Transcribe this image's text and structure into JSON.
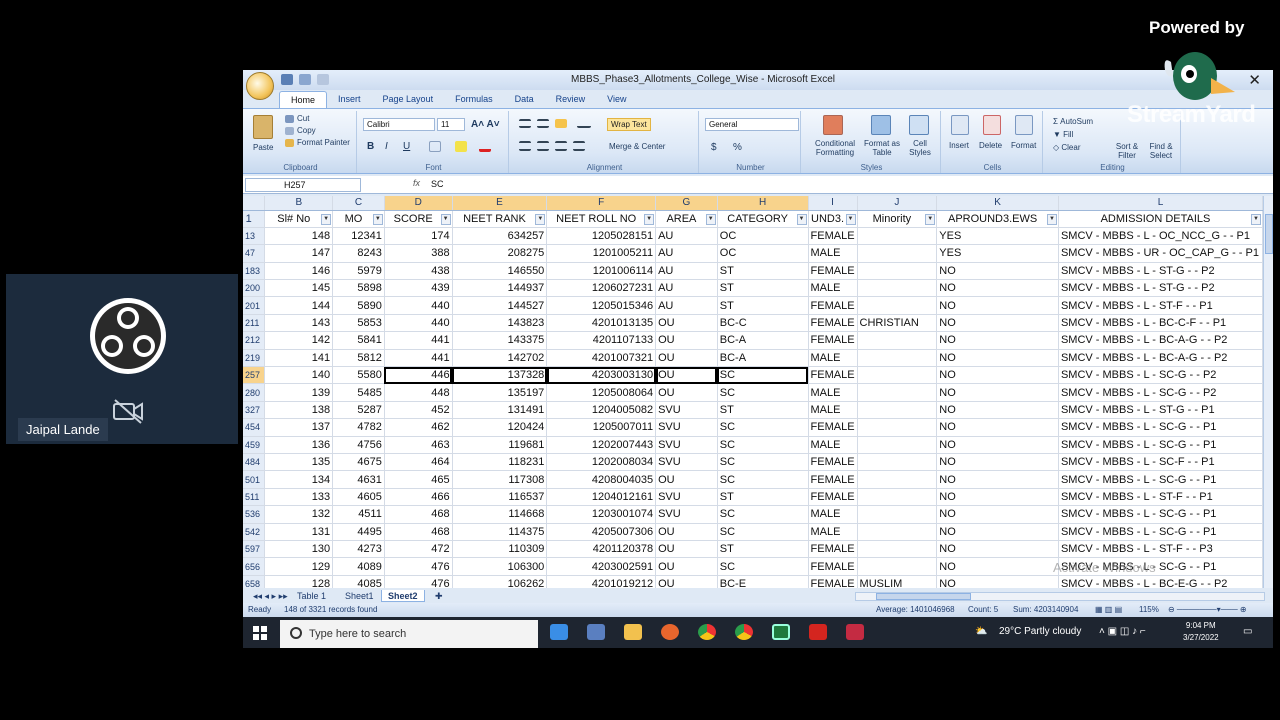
{
  "overlay": {
    "powered_by": "Powered by",
    "brand": "StreamYard",
    "participant_name": "Jaipal Lande"
  },
  "window": {
    "title": "MBBS_Phase3_Allotments_College_Wise - Microsoft Excel"
  },
  "tabs": [
    "Home",
    "Insert",
    "Page Layout",
    "Formulas",
    "Data",
    "Review",
    "View"
  ],
  "ribbon": {
    "clipboard": {
      "paste": "Paste",
      "cut": "Cut",
      "copy": "Copy",
      "format_painter": "Format Painter",
      "label": "Clipboard"
    },
    "font": {
      "name": "Calibri",
      "size": "11",
      "label": "Font",
      "bold": "B",
      "italic": "I",
      "underline": "U"
    },
    "alignment": {
      "wrap_text": "Wrap Text",
      "merge_center": "Merge & Center",
      "label": "Alignment"
    },
    "number": {
      "format": "General",
      "currency": "$",
      "percent": "%",
      "label": "Number"
    },
    "styles": {
      "conditional": "Conditional Formatting",
      "format_table": "Format as Table",
      "cell_styles": "Cell Styles",
      "label": "Styles"
    },
    "cells": {
      "insert": "Insert",
      "delete": "Delete",
      "format": "Format",
      "label": "Cells"
    },
    "editing": {
      "autosum": "AutoSum",
      "fill": "Fill",
      "clear": "Clear",
      "sort": "Sort & Filter",
      "find": "Find & Select",
      "label": "Editing"
    }
  },
  "formula_bar": {
    "name_box": "H257",
    "fx": "fx",
    "content": "SC"
  },
  "columns": [
    "B",
    "C",
    "D",
    "E",
    "F",
    "G",
    "H",
    "I",
    "J",
    "K",
    "L"
  ],
  "header_row_num": "1",
  "headers": [
    "Sl# No",
    "MO",
    "SCORE",
    "NEET RANK",
    "NEET ROLL NO",
    "AREA",
    "CATEGORY",
    "UND3.",
    "Minority",
    "APROUND3.EWS",
    "ADMISSION DETAILS"
  ],
  "rows": [
    {
      "r": "13",
      "cells": [
        "148",
        "12341",
        "174",
        "634257",
        "1205028151",
        "AU",
        "OC",
        "FEMALE",
        "",
        "YES",
        "SMCV - MBBS - L - OC_NCC_G - - P1"
      ]
    },
    {
      "r": "47",
      "cells": [
        "147",
        "8243",
        "388",
        "208275",
        "1201005211",
        "AU",
        "OC",
        "MALE",
        "",
        "YES",
        "SMCV - MBBS - UR - OC_CAP_G - - P1"
      ]
    },
    {
      "r": "183",
      "cells": [
        "146",
        "5979",
        "438",
        "146550",
        "1201006114",
        "AU",
        "ST",
        "FEMALE",
        "",
        "NO",
        "SMCV - MBBS - L - ST-G - - P2"
      ]
    },
    {
      "r": "200",
      "cells": [
        "145",
        "5898",
        "439",
        "144937",
        "1206027231",
        "AU",
        "ST",
        "MALE",
        "",
        "NO",
        "SMCV - MBBS - L - ST-G - - P2"
      ]
    },
    {
      "r": "201",
      "cells": [
        "144",
        "5890",
        "440",
        "144527",
        "1205015346",
        "AU",
        "ST",
        "FEMALE",
        "",
        "NO",
        "SMCV - MBBS - L - ST-F - - P1"
      ]
    },
    {
      "r": "211",
      "cells": [
        "143",
        "5853",
        "440",
        "143823",
        "4201013135",
        "OU",
        "BC-C",
        "FEMALE",
        "CHRISTIAN",
        "NO",
        "SMCV - MBBS - L - BC-C-F - - P1"
      ]
    },
    {
      "r": "212",
      "cells": [
        "142",
        "5841",
        "441",
        "143375",
        "4201107133",
        "OU",
        "BC-A",
        "FEMALE",
        "",
        "NO",
        "SMCV - MBBS - L - BC-A-G - - P2"
      ]
    },
    {
      "r": "219",
      "cells": [
        "141",
        "5812",
        "441",
        "142702",
        "4201007321",
        "OU",
        "BC-A",
        "MALE",
        "",
        "NO",
        "SMCV - MBBS - L - BC-A-G - - P2"
      ]
    },
    {
      "r": "257",
      "cells": [
        "140",
        "5580",
        "446",
        "137328",
        "4203003130",
        "OU",
        "SC",
        "FEMALE",
        "",
        "NO",
        "SMCV - MBBS - L - SC-G - - P2"
      ]
    },
    {
      "r": "280",
      "cells": [
        "139",
        "5485",
        "448",
        "135197",
        "1205008064",
        "OU",
        "SC",
        "MALE",
        "",
        "NO",
        "SMCV - MBBS - L - SC-G - - P2"
      ]
    },
    {
      "r": "327",
      "cells": [
        "138",
        "5287",
        "452",
        "131491",
        "1204005082",
        "SVU",
        "ST",
        "MALE",
        "",
        "NO",
        "SMCV - MBBS - L - ST-G - - P1"
      ]
    },
    {
      "r": "454",
      "cells": [
        "137",
        "4782",
        "462",
        "120424",
        "1205007011",
        "SVU",
        "SC",
        "FEMALE",
        "",
        "NO",
        "SMCV - MBBS - L - SC-G - - P1"
      ]
    },
    {
      "r": "459",
      "cells": [
        "136",
        "4756",
        "463",
        "119681",
        "1202007443",
        "SVU",
        "SC",
        "MALE",
        "",
        "NO",
        "SMCV - MBBS - L - SC-G - - P1"
      ]
    },
    {
      "r": "484",
      "cells": [
        "135",
        "4675",
        "464",
        "118231",
        "1202008034",
        "SVU",
        "SC",
        "FEMALE",
        "",
        "NO",
        "SMCV - MBBS - L - SC-F - - P1"
      ]
    },
    {
      "r": "501",
      "cells": [
        "134",
        "4631",
        "465",
        "117308",
        "4208004035",
        "OU",
        "SC",
        "FEMALE",
        "",
        "NO",
        "SMCV - MBBS - L - SC-G - - P1"
      ]
    },
    {
      "r": "511",
      "cells": [
        "133",
        "4605",
        "466",
        "116537",
        "1204012161",
        "SVU",
        "ST",
        "FEMALE",
        "",
        "NO",
        "SMCV - MBBS - L - ST-F - - P1"
      ]
    },
    {
      "r": "536",
      "cells": [
        "132",
        "4511",
        "468",
        "114668",
        "1203001074",
        "SVU",
        "SC",
        "MALE",
        "",
        "NO",
        "SMCV - MBBS - L - SC-G - - P1"
      ]
    },
    {
      "r": "542",
      "cells": [
        "131",
        "4495",
        "468",
        "114375",
        "4205007306",
        "OU",
        "SC",
        "MALE",
        "",
        "NO",
        "SMCV - MBBS - L - SC-G - - P1"
      ]
    },
    {
      "r": "597",
      "cells": [
        "130",
        "4273",
        "472",
        "110309",
        "4201120378",
        "OU",
        "ST",
        "FEMALE",
        "",
        "NO",
        "SMCV - MBBS - L - ST-F - - P3"
      ]
    },
    {
      "r": "656",
      "cells": [
        "129",
        "4089",
        "476",
        "106300",
        "4203002591",
        "OU",
        "SC",
        "FEMALE",
        "",
        "NO",
        "SMCV - MBBS - L - SC-G - - P1"
      ]
    },
    {
      "r": "658",
      "cells": [
        "128",
        "4085",
        "476",
        "106262",
        "4201019212",
        "OU",
        "BC-E",
        "FEMALE",
        "MUSLIM",
        "NO",
        "SMCV - MBBS - L - BC-E-G - - P2"
      ]
    }
  ],
  "sheet_tabs": [
    "Table 1",
    "Sheet1",
    "Sheet2"
  ],
  "status": {
    "ready": "Ready",
    "records": "148 of 3321 records found",
    "average": "Average: 1401046968",
    "count": "Count: 5",
    "sum": "Sum: 4203140904",
    "zoom": "115%"
  },
  "taskbar": {
    "search_placeholder": "Type here to search",
    "weather": "29°C  Partly cloudy",
    "time": "9:04 PM",
    "date": "3/27/2022"
  },
  "watermark": "Activate Windows"
}
